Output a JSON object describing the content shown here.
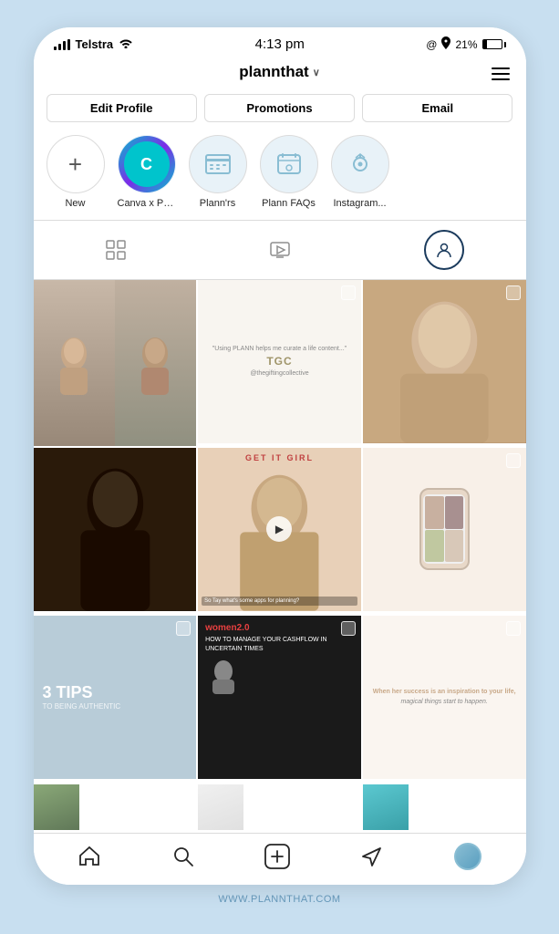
{
  "status_bar": {
    "carrier": "Telstra",
    "time": "4:13 pm",
    "battery_percent": "21%",
    "location_icon": "●",
    "navigation_icon": "▲"
  },
  "header": {
    "username": "plannthat",
    "chevron": "∨",
    "menu_icon": "≡"
  },
  "profile_buttons": {
    "edit_profile": "Edit Profile",
    "promotions": "Promotions",
    "email": "Email"
  },
  "stories": [
    {
      "label": "New",
      "type": "add"
    },
    {
      "label": "Canva x Pla...",
      "type": "canva"
    },
    {
      "label": "Plann'rs",
      "type": "icon"
    },
    {
      "label": "Plann FAQs",
      "type": "icon"
    },
    {
      "label": "Instagram...",
      "type": "icon"
    }
  ],
  "tabs": [
    {
      "id": "grid",
      "icon": "⊞",
      "active": false
    },
    {
      "id": "igtv",
      "icon": "📺",
      "active": false
    },
    {
      "id": "tagged",
      "icon": "👤",
      "active": true
    }
  ],
  "grid_cells": [
    {
      "id": "cell1",
      "type": "face"
    },
    {
      "id": "cell2",
      "type": "tgc"
    },
    {
      "id": "cell3",
      "type": "photo"
    },
    {
      "id": "cell4",
      "type": "dark-girl"
    },
    {
      "id": "cell5",
      "type": "getit"
    },
    {
      "id": "cell6",
      "type": "phone"
    },
    {
      "id": "cell7",
      "type": "tips"
    },
    {
      "id": "cell8",
      "type": "women"
    },
    {
      "id": "cell9",
      "type": "quote"
    },
    {
      "id": "cell10",
      "type": "nature"
    },
    {
      "id": "cell11",
      "type": "partial"
    }
  ],
  "bottom_nav": {
    "home": "🏠",
    "search": "🔍",
    "add": "➕",
    "send": "✈",
    "profile": "avatar"
  },
  "website": "WWW.PLANNTHAT.COM"
}
